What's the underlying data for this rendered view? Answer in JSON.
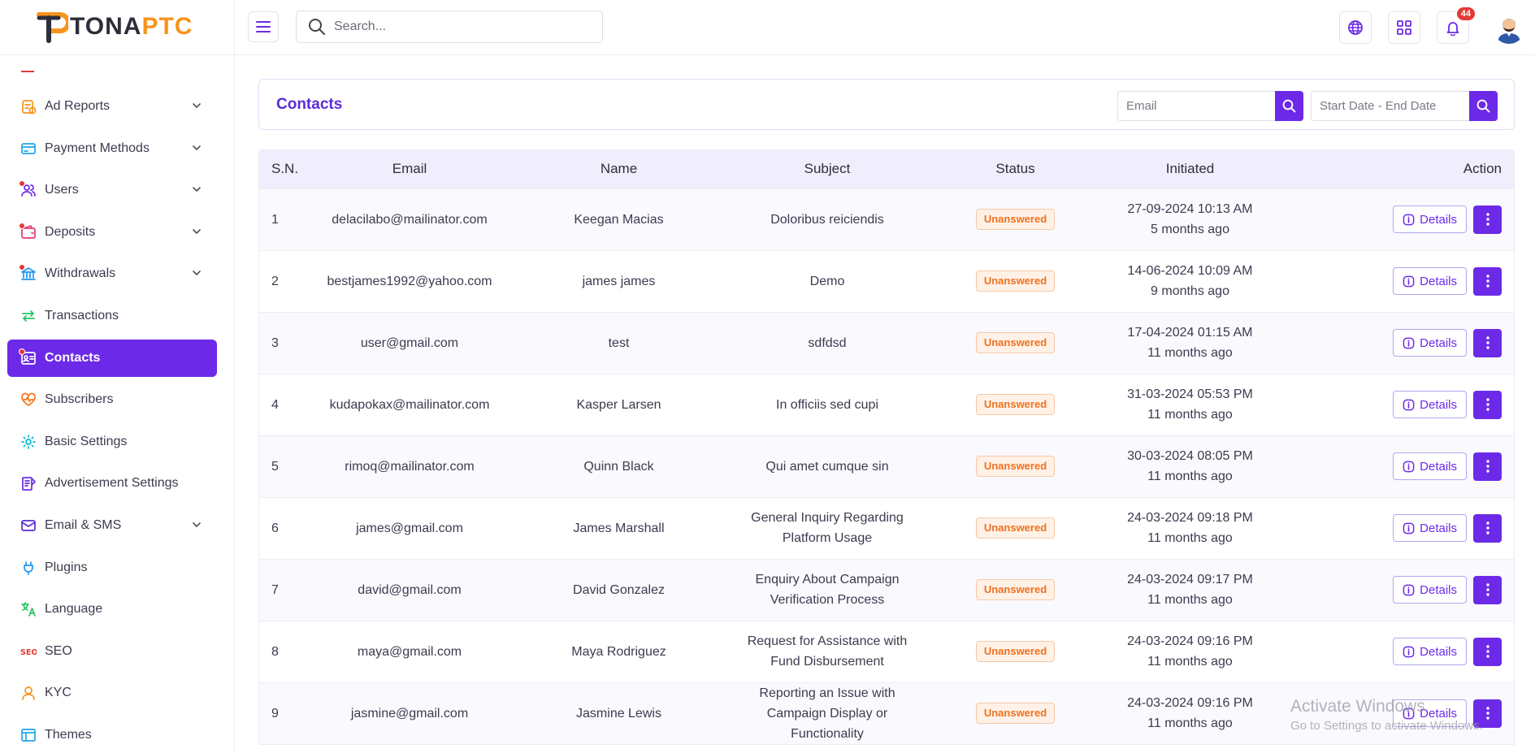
{
  "brand": {
    "part1": "TONA",
    "part2": "PTC",
    "accent": "#6c2ae8",
    "orange": "#f7941d"
  },
  "sidebar": {
    "items": [
      {
        "label": "Ad Reports",
        "icon": "ad-report-icon",
        "chevron": true,
        "dot": false,
        "color": "#f7941d"
      },
      {
        "label": "Payment Methods",
        "icon": "credit-card-icon",
        "chevron": true,
        "dot": false,
        "color": "#22a4e6"
      },
      {
        "label": "Users",
        "icon": "users-icon",
        "chevron": true,
        "dot": true,
        "color": "#6c2ae8"
      },
      {
        "label": "Deposits",
        "icon": "wallet-icon",
        "chevron": true,
        "dot": true,
        "color": "#e53978"
      },
      {
        "label": "Withdrawals",
        "icon": "bank-icon",
        "chevron": true,
        "dot": true,
        "color": "#2196f3"
      },
      {
        "label": "Transactions",
        "icon": "transfer-icon",
        "chevron": false,
        "dot": false,
        "color": "#22c55e"
      },
      {
        "label": "Contacts",
        "icon": "contact-card-icon",
        "chevron": false,
        "dot": true,
        "active": true,
        "color": "#ffffff"
      },
      {
        "label": "Subscribers",
        "icon": "heart-pulse-icon",
        "chevron": false,
        "dot": false,
        "color": "#f97316"
      },
      {
        "label": "Basic Settings",
        "icon": "gear-icon",
        "chevron": false,
        "dot": false,
        "color": "#06b6d4"
      },
      {
        "label": "Advertisement Settings",
        "icon": "ad-settings-icon",
        "chevron": false,
        "dot": false,
        "color": "#6c2ae8"
      },
      {
        "label": "Email & SMS",
        "icon": "envelope-icon",
        "chevron": true,
        "dot": false,
        "color": "#5b2bd6"
      },
      {
        "label": "Plugins",
        "icon": "plug-icon",
        "chevron": false,
        "dot": false,
        "color": "#2196f3"
      },
      {
        "label": "Language",
        "icon": "translate-icon",
        "chevron": false,
        "dot": false,
        "color": "#22c55e"
      },
      {
        "label": "SEO",
        "icon": "seo-icon",
        "chevron": false,
        "dot": false,
        "color": "#e53935"
      },
      {
        "label": "KYC",
        "icon": "user-icon",
        "chevron": false,
        "dot": false,
        "color": "#f7941d"
      },
      {
        "label": "Themes",
        "icon": "layout-icon",
        "chevron": false,
        "dot": false,
        "color": "#22a4e6"
      }
    ]
  },
  "topbar": {
    "search_placeholder": "Search...",
    "notification_count": "44"
  },
  "page": {
    "title": "Contacts",
    "email_placeholder": "Email",
    "date_placeholder": "Start Date - End Date"
  },
  "table": {
    "headers": {
      "sn": "S.N.",
      "email": "Email",
      "name": "Name",
      "subject": "Subject",
      "status": "Status",
      "initiated": "Initiated",
      "action": "Action"
    },
    "details_label": "Details",
    "rows": [
      {
        "sn": "1",
        "email": "delacilabo@mailinator.com",
        "name": "Keegan Macias",
        "subject": "Doloribus reiciendis",
        "status": "Unanswered",
        "date": "27-09-2024 10:13 AM",
        "ago": "5 months ago"
      },
      {
        "sn": "2",
        "email": "bestjames1992@yahoo.com",
        "name": "james james",
        "subject": "Demo",
        "status": "Unanswered",
        "date": "14-06-2024 10:09 AM",
        "ago": "9 months ago"
      },
      {
        "sn": "3",
        "email": "user@gmail.com",
        "name": "test",
        "subject": "sdfdsd",
        "status": "Unanswered",
        "date": "17-04-2024 01:15 AM",
        "ago": "11 months ago"
      },
      {
        "sn": "4",
        "email": "kudapokax@mailinator.com",
        "name": "Kasper Larsen",
        "subject": "In officiis sed cupi",
        "status": "Unanswered",
        "date": "31-03-2024 05:53 PM",
        "ago": "11 months ago"
      },
      {
        "sn": "5",
        "email": "rimoq@mailinator.com",
        "name": "Quinn Black",
        "subject": "Qui amet cumque sin",
        "status": "Unanswered",
        "date": "30-03-2024 08:05 PM",
        "ago": "11 months ago"
      },
      {
        "sn": "6",
        "email": "james@gmail.com",
        "name": "James Marshall",
        "subject": "General Inquiry Regarding Platform Usage",
        "status": "Unanswered",
        "date": "24-03-2024 09:18 PM",
        "ago": "11 months ago"
      },
      {
        "sn": "7",
        "email": "david@gmail.com",
        "name": "David Gonzalez",
        "subject": "Enquiry About Campaign Verification Process",
        "status": "Unanswered",
        "date": "24-03-2024 09:17 PM",
        "ago": "11 months ago"
      },
      {
        "sn": "8",
        "email": "maya@gmail.com",
        "name": "Maya Rodriguez",
        "subject": "Request for Assistance with Fund Disbursement",
        "status": "Unanswered",
        "date": "24-03-2024 09:16 PM",
        "ago": "11 months ago"
      },
      {
        "sn": "9",
        "email": "jasmine@gmail.com",
        "name": "Jasmine Lewis",
        "subject": "Reporting an Issue with Campaign Display or Functionality",
        "status": "Unanswered",
        "date": "24-03-2024 09:16 PM",
        "ago": "11 months ago"
      }
    ]
  },
  "watermark": {
    "line1": "Activate Windows",
    "line2": "Go to Settings to activate Windows."
  }
}
